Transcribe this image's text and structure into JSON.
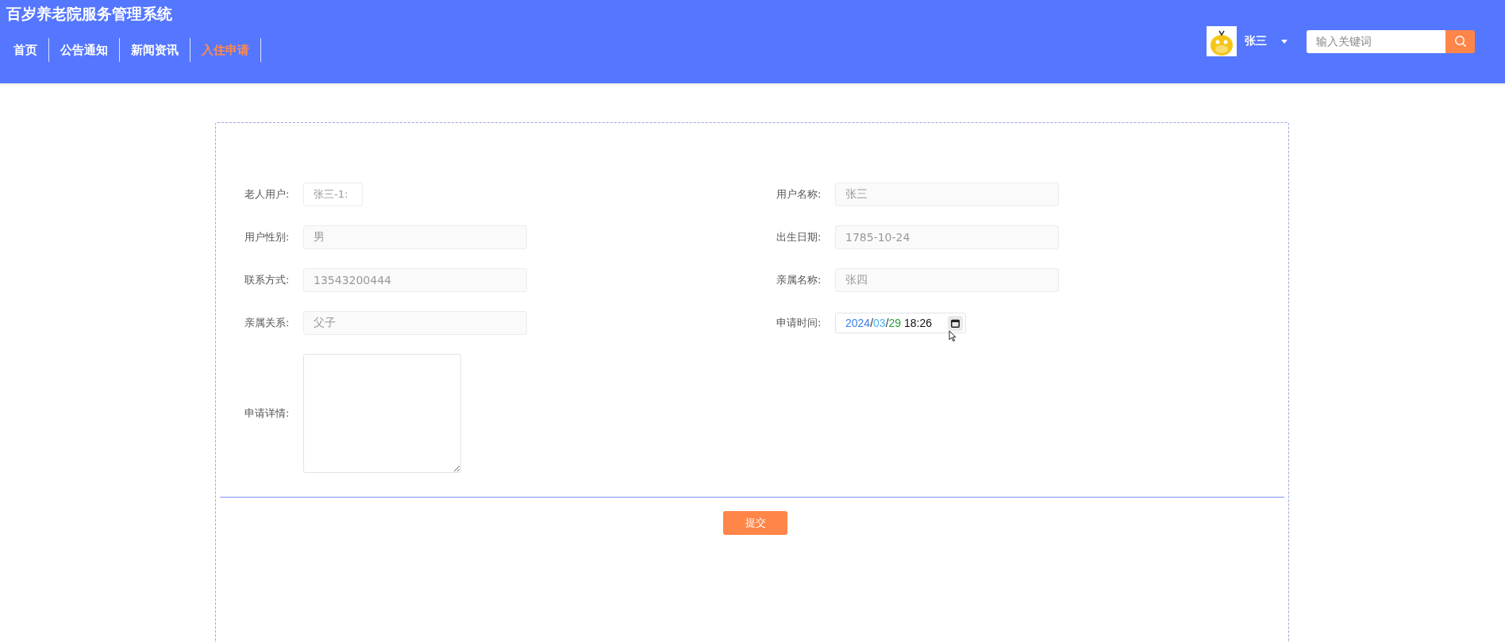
{
  "header": {
    "title": "百岁养老院服务管理系统",
    "nav": [
      {
        "label": "首页",
        "selected": false
      },
      {
        "label": "公告通知",
        "selected": false
      },
      {
        "label": "新闻资讯",
        "selected": false
      },
      {
        "label": "入住申请",
        "selected": true
      }
    ],
    "user": {
      "name": "张三"
    },
    "search": {
      "placeholder": "输入关键词"
    }
  },
  "form": {
    "rows": [
      {
        "cells": [
          {
            "kind": "short",
            "label": "老人用户:",
            "value": "张三-1:"
          },
          {
            "kind": "text",
            "label": "用户名称:",
            "value": "张三"
          }
        ]
      },
      {
        "cells": [
          {
            "kind": "text",
            "label": "用户性别:",
            "value": "男"
          },
          {
            "kind": "text",
            "label": "出生日期:",
            "value": "1785-10-24"
          }
        ]
      },
      {
        "cells": [
          {
            "kind": "text",
            "label": "联系方式:",
            "value": "13543200444"
          },
          {
            "kind": "text",
            "label": "亲属名称:",
            "value": "张四"
          }
        ]
      },
      {
        "cells": [
          {
            "kind": "text",
            "label": "亲属关系:",
            "value": "父子"
          },
          {
            "kind": "datetime",
            "label": "申请时间:",
            "segments": [
              {
                "text": "2024",
                "color": "#3b7fe6"
              },
              {
                "text": "/",
                "color": "#333333"
              },
              {
                "text": "03",
                "color": "#4bb4f2"
              },
              {
                "text": "/",
                "color": "#333333"
              },
              {
                "text": "29",
                "color": "#2e9e3e"
              },
              {
                "text": " 18:26",
                "color": "#111111"
              }
            ]
          }
        ]
      },
      {
        "cells": [
          {
            "kind": "textarea",
            "label": "申请详情:"
          }
        ]
      }
    ],
    "submit": "提交"
  }
}
